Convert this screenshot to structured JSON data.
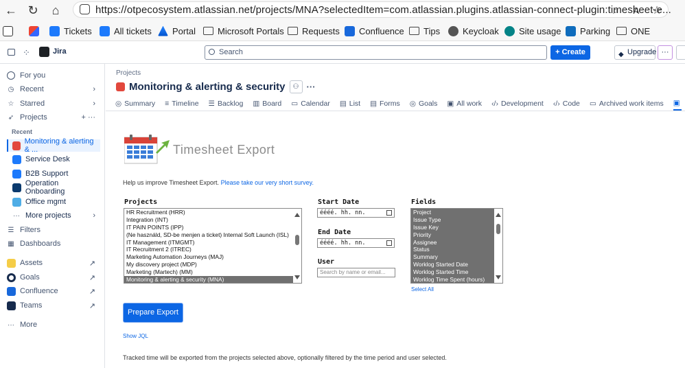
{
  "browser": {
    "url": "https://otpecosystem.atlassian.net/projects/MNA?selectedItem=com.atlassian.plugins.atlassian-connect-plugin:timesheet-e...",
    "bookmarks": [
      {
        "label": "",
        "icon": "collection-icon"
      },
      {
        "label": "",
        "icon": "office-icon"
      },
      {
        "label": "Tickets",
        "icon": "jira-service-icon"
      },
      {
        "label": "All tickets",
        "icon": "jira-service-icon"
      },
      {
        "label": "Portal",
        "icon": "portal-icon"
      },
      {
        "label": "Microsoft Portals",
        "icon": "folder-icon"
      },
      {
        "label": "Requests",
        "icon": "folder-icon"
      },
      {
        "label": "Confluence",
        "icon": "confluence-icon"
      },
      {
        "label": "Tips",
        "icon": "folder-icon"
      },
      {
        "label": "Keycloak",
        "icon": "keycloak-icon"
      },
      {
        "label": "Site usage",
        "icon": "sharepoint-icon"
      },
      {
        "label": "Parking",
        "icon": "outlook-icon"
      },
      {
        "label": "ONE",
        "icon": "folder-icon"
      }
    ]
  },
  "topbar": {
    "app_name": "Jira",
    "search_placeholder": "Search",
    "create_label": "Create",
    "upgrade_label": "Upgrade",
    "more_label": "···"
  },
  "sidebar": {
    "items": [
      {
        "label": "For you",
        "icon": "user-icon"
      },
      {
        "label": "Recent",
        "icon": "clock-icon",
        "right": "›"
      },
      {
        "label": "Starred",
        "icon": "star-icon",
        "right": "›"
      },
      {
        "label": "Projects",
        "icon": "rocket-icon",
        "right": "+  ···"
      }
    ],
    "recent_heading": "Recent",
    "projects": [
      {
        "label": "Monitoring & alerting & ...",
        "color": "#e2483d",
        "active": true
      },
      {
        "label": "Service Desk",
        "color": "#1d7afc"
      },
      {
        "label": "B2B Support",
        "color": "#1d7afc"
      },
      {
        "label": "Operation Onboarding",
        "color": "#0b3a6e"
      },
      {
        "label": "Office mgmt",
        "color": "#4fade6"
      }
    ],
    "more_projects": "More projects",
    "filters": "Filters",
    "dashboards": "Dashboards",
    "apps": [
      {
        "label": "Assets",
        "color": "#f5cd47"
      },
      {
        "label": "Goals",
        "color": "#172b4d"
      },
      {
        "label": "Confluence",
        "color": "#1868db"
      },
      {
        "label": "Teams",
        "color": "#172b4d"
      }
    ],
    "more": "More"
  },
  "main": {
    "breadcrumb": "Projects",
    "title": "Monitoring & alerting & security",
    "tabs": [
      "Summary",
      "Timeline",
      "Backlog",
      "Board",
      "Calendar",
      "List",
      "Forms",
      "Goals",
      "All work",
      "Development",
      "Code",
      "Archived work items"
    ],
    "app_title": "Timesheet Export",
    "survey_text": "Help us improve Timesheet Export. ",
    "survey_link": "Please take our very short survey.",
    "projects_label": "Projects",
    "projects": [
      "HR Recruitment (HRR)",
      "Integration (INT)",
      "IT PAIN POINTS (IPP)",
      "(Ne használd, SD-be menjen a ticket) Internal Soft Launch (ISL)",
      "IT Management (ITMGMT)",
      "IT Recruitment 2 (ITREC)",
      "Marketing Automation Journeys (MAJ)",
      "My discovery project (MDP)",
      "Marketing (Martech) (MM)",
      "Monitoring & alerting & security (MNA)"
    ],
    "start_label": "Start Date",
    "start_value": "éééé. hh. nn.",
    "end_label": "End Date",
    "end_value": "éééé. hh. nn.",
    "user_label": "User",
    "user_placeholder": "Search by name or email...",
    "fields_label": "Fields",
    "fields": [
      "Project",
      "Issue Type",
      "Issue Key",
      "Priority",
      "Assignee",
      "Status",
      "Summary",
      "Worklog Started Date",
      "Worklog Started Time",
      "Worklog Time Spent (hours)"
    ],
    "select_all": "Select All",
    "prepare_label": "Prepare Export",
    "show_jql": "Show JQL",
    "footer_text": "Tracked time will be exported from the projects selected above, optionally filtered by the time period and user selected."
  }
}
